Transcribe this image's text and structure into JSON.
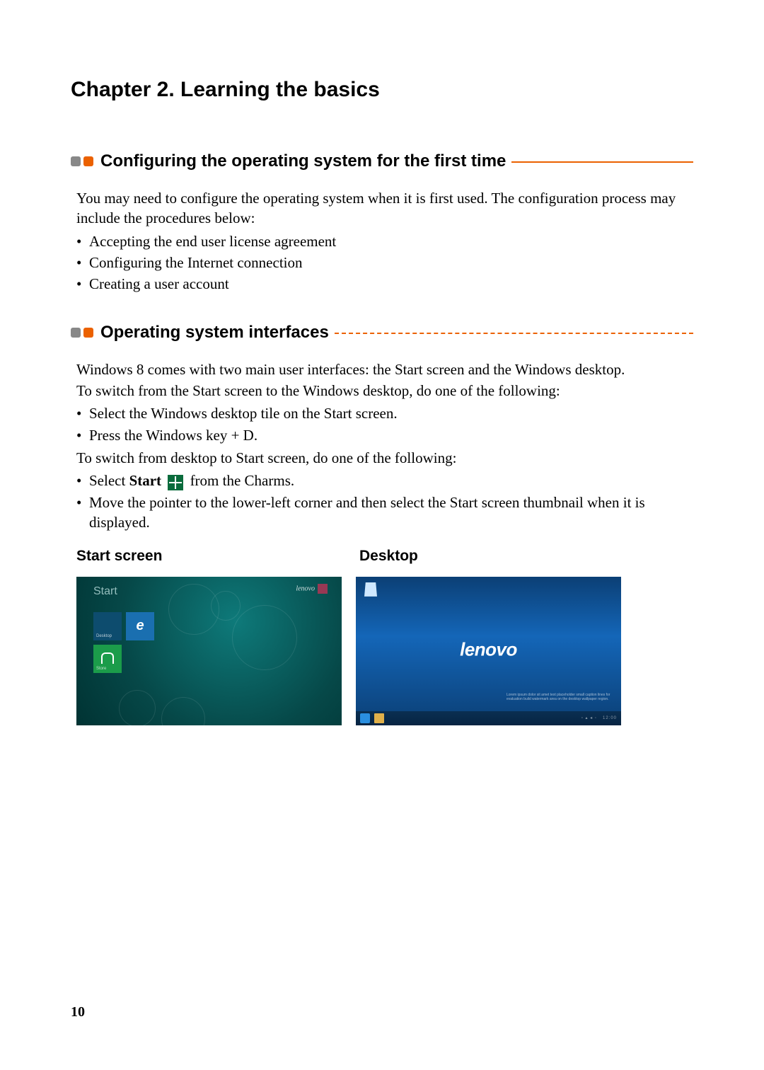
{
  "chapter_title": "Chapter 2. Learning the basics",
  "section1": {
    "title": "Configuring the operating system for the first time",
    "intro": "You may need to configure the operating system when it is first used. The configuration process may include the procedures below:",
    "items": [
      "Accepting the end user license agreement",
      "Configuring the Internet connection",
      "Creating a user account"
    ]
  },
  "section2": {
    "title": "Operating system interfaces",
    "para1": "Windows 8 comes with two main user interfaces: the Start screen and the Windows desktop.",
    "para2": "To switch from the Start screen to the Windows desktop, do one of the following:",
    "switch_to_desktop": [
      "Select the Windows desktop tile on the Start screen.",
      "Press the Windows key + D."
    ],
    "para3": "To switch from desktop to Start screen, do one of the following:",
    "select_start_pre": "Select ",
    "select_start_bold": "Start",
    "select_start_post": " from the Charms.",
    "move_pointer": "Move the pointer to the lower-left corner and then select the Start screen thumbnail when it is displayed.",
    "labels": {
      "start": "Start screen",
      "desktop": "Desktop"
    }
  },
  "start_screen": {
    "label": "Start",
    "user": "lenovo"
  },
  "desktop_screen": {
    "logo": "lenovo"
  },
  "page_number": "10"
}
